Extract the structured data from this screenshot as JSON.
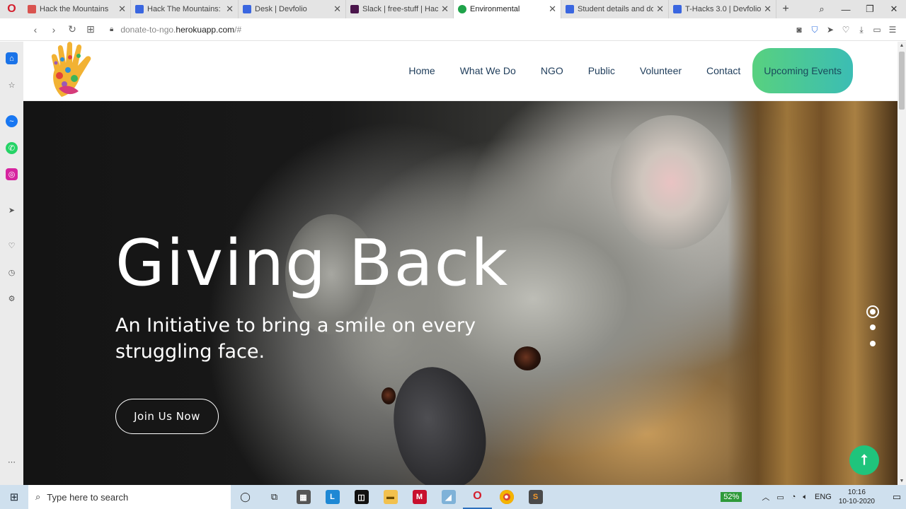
{
  "browser": {
    "tabs": [
      {
        "title": "Hack the Mountains",
        "favicon_color": "#d9534f",
        "active": false
      },
      {
        "title": "Hack The Mountains: Da",
        "favicon_color": "#3a66e0",
        "active": false
      },
      {
        "title": "Desk | Devfolio",
        "favicon_color": "#3a66e0",
        "active": false
      },
      {
        "title": "Slack | free-stuff | Hack t",
        "favicon_color": "#4a154b",
        "active": false
      },
      {
        "title": "Environmental",
        "favicon_color": "#1fa34a",
        "active": true
      },
      {
        "title": "Student details and doc",
        "favicon_color": "#3a66e0",
        "active": false
      },
      {
        "title": "T-Hacks 3.0 | Devfolio",
        "favicon_color": "#3a66e0",
        "active": false
      }
    ],
    "url_prefix": "donate-to-ngo.",
    "url_host": "herokuapp.com",
    "url_suffix": "/#"
  },
  "site": {
    "nav": {
      "home": "Home",
      "what_we_do": "What We Do",
      "ngo": "NGO",
      "public": "Public",
      "volunteer": "Volunteer",
      "contact": "Contact",
      "upcoming_events": "Upcoming Events"
    },
    "hero": {
      "title": "Giving Back",
      "subtitle": "An Initiative to bring a smile on every struggling face.",
      "cta": "Join Us Now",
      "slide_count": 3,
      "active_slide": 1
    },
    "colors": {
      "accent_gradient_start": "#58d17f",
      "accent_gradient_end": "#3bbdb4",
      "scroll_top_button": "#1fc47c"
    }
  },
  "taskbar": {
    "search_placeholder": "Type here to search",
    "battery": "52%",
    "language": "ENG",
    "time": "10:16",
    "date": "10-10-2020"
  }
}
